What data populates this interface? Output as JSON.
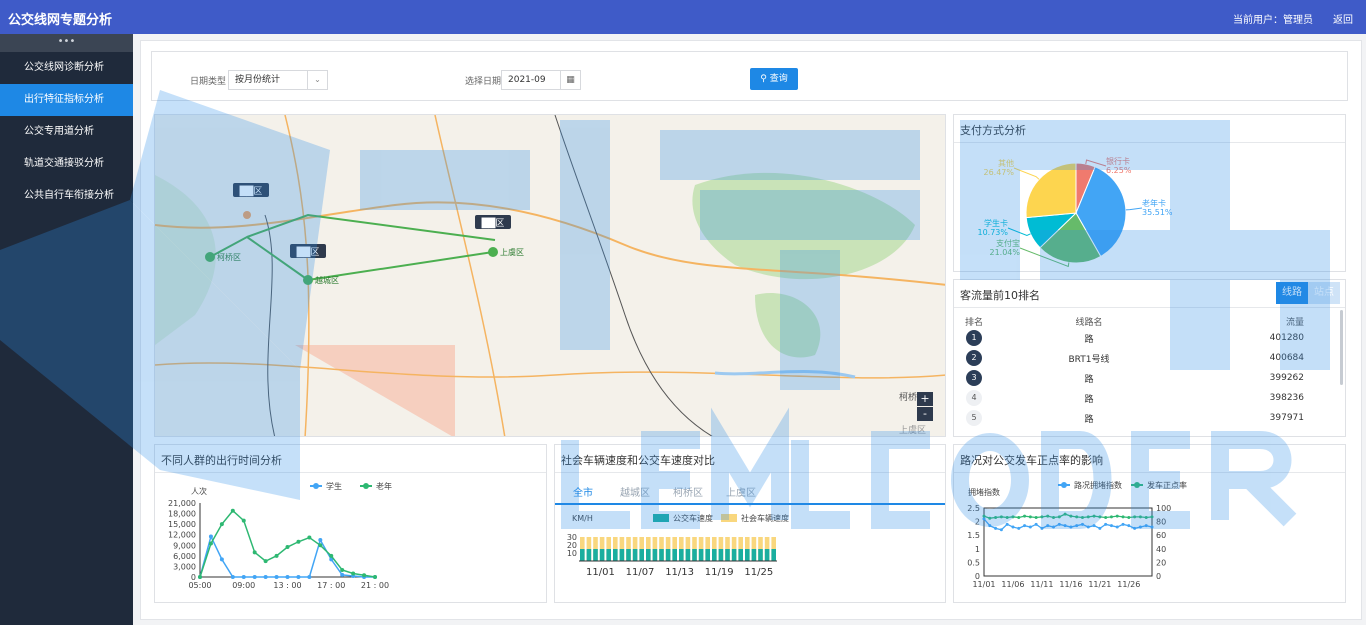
{
  "app": {
    "title": "公交线网专题分析",
    "user_label": "当前用户：管理员",
    "back_label": "返回"
  },
  "sidebar": {
    "collapse": "•••",
    "items": [
      {
        "label": "公交线网诊断分析"
      },
      {
        "label": "出行特征指标分析"
      },
      {
        "label": "公交专用道分析"
      },
      {
        "label": "轨道交通接驳分析"
      },
      {
        "label": "公共自行车衔接分析"
      }
    ]
  },
  "filter": {
    "date_type_label": "日期类型",
    "date_type_value": "按月份统计",
    "select_date_label": "选择日期",
    "select_date_value": "2021-09",
    "query_label": "查询"
  },
  "map": {
    "districts": [
      "██区",
      "██区",
      "██区"
    ],
    "points": [
      "柯桥区",
      "越城区",
      "上虞区"
    ],
    "zoom_in": "+",
    "zoom_out": "-",
    "corner_labels": [
      "柯桥区",
      "上虞区"
    ]
  },
  "payment": {
    "title": "支付方式分析",
    "chart_data": {
      "type": "pie",
      "slices": [
        {
          "name": "银行卡",
          "value": 6.25,
          "label": "6.25%",
          "color": "#f07a6e"
        },
        {
          "name": "老年卡",
          "value": 35.51,
          "label": "35.51%",
          "color": "#42a5f5"
        },
        {
          "name": "支付宝",
          "value": 21.04,
          "label": "21.04%",
          "color": "#66bb6a"
        },
        {
          "name": "学生卡",
          "value": 10.73,
          "label": "10.73%",
          "color": "#00bcd4"
        },
        {
          "name": "其他",
          "value": 26.47,
          "label": "26.47%",
          "color": "#fdd54f"
        }
      ]
    }
  },
  "ranking": {
    "title": "客流量前10排名",
    "tabs": [
      {
        "label": "线路",
        "active": true
      },
      {
        "label": "站点",
        "active": false
      }
    ],
    "headers": [
      "排名",
      "线路名",
      "流量"
    ],
    "rows": [
      {
        "rank": "1",
        "name": "路",
        "flow": "401280"
      },
      {
        "rank": "2",
        "name": "BRT1号线",
        "flow": "400684"
      },
      {
        "rank": "3",
        "name": "路",
        "flow": "399262"
      },
      {
        "rank": "4",
        "name": "路",
        "flow": "398236"
      },
      {
        "rank": "5",
        "name": "路",
        "flow": "397971"
      }
    ]
  },
  "crowd": {
    "title": "不同人群的出行时间分析",
    "chart_data": {
      "type": "line",
      "ylabel": "人次",
      "x_ticks": [
        "05:00",
        "09:00",
        "13 : 00",
        "17 : 00",
        "21 : 00"
      ],
      "y_ticks": [
        "0",
        "3,000",
        "6,000",
        "9,000",
        "12,000",
        "15,000",
        "18,000",
        "21,000"
      ],
      "ylim": [
        0,
        21000
      ],
      "series": [
        {
          "name": "学生",
          "color": "#42a5f5",
          "values": [
            0,
            11500,
            5000,
            0,
            0,
            0,
            0,
            0,
            0,
            0,
            0,
            10500,
            5000,
            600,
            300,
            0,
            0
          ]
        },
        {
          "name": "老年",
          "color": "#2eb872",
          "values": [
            0,
            9500,
            15000,
            18800,
            16000,
            7000,
            4500,
            6000,
            8500,
            10000,
            11200,
            9000,
            6000,
            2000,
            1000,
            500,
            0
          ]
        }
      ]
    }
  },
  "speed": {
    "title": "社会车辆速度和公交车速度对比",
    "tabs": [
      {
        "label": "全市"
      },
      {
        "label": "越城区"
      },
      {
        "label": "柯桥区"
      },
      {
        "label": "上虞区"
      }
    ],
    "chart_data": {
      "type": "bar",
      "ylabel": "KM/H",
      "x_ticks": [
        "11/01",
        "11/07",
        "11/13",
        "11/19",
        "11/25"
      ],
      "y_ticks": [
        "10",
        "20",
        "30"
      ],
      "ylim": [
        0,
        30
      ],
      "series": [
        {
          "name": "公交车速度",
          "color": "#1aae9f",
          "value_each_day": 15
        },
        {
          "name": "社会车辆速度",
          "color": "#f9d77e",
          "value_each_day": 30
        }
      ],
      "day_count": 30
    }
  },
  "punctuality": {
    "title": "路况对公交发车正点率的影响",
    "chart_data": {
      "type": "line",
      "ylabel": "拥堵指数",
      "x_ticks": [
        "11/01",
        "11/06",
        "11/11",
        "11/16",
        "11/21",
        "11/26"
      ],
      "y_left_ticks": [
        "0",
        "0.5",
        "1",
        "1.5",
        "2",
        "2.5"
      ],
      "y_right_ticks": [
        "0",
        "20",
        "40",
        "60",
        "80",
        "100"
      ],
      "series": [
        {
          "name": "路况拥堵指数",
          "color": "#42a5f5",
          "axis": "left",
          "values": [
            2.1,
            1.85,
            1.75,
            1.7,
            1.9,
            1.8,
            1.75,
            1.85,
            1.8,
            1.9,
            1.75,
            1.85,
            1.8,
            1.9,
            1.85,
            1.8,
            1.85,
            1.9,
            1.8,
            1.85,
            1.75,
            1.9,
            1.85,
            1.8,
            1.9,
            1.85,
            1.75,
            1.8,
            1.85,
            1.8
          ]
        },
        {
          "name": "发车正点率",
          "color": "#2eb872",
          "axis": "right",
          "values": [
            88,
            85,
            86,
            87,
            86,
            87,
            86,
            88,
            87,
            86,
            87,
            88,
            86,
            87,
            91,
            88,
            87,
            86,
            87,
            88,
            87,
            86,
            87,
            88,
            87,
            86,
            87,
            87,
            86,
            87
          ]
        }
      ]
    }
  }
}
